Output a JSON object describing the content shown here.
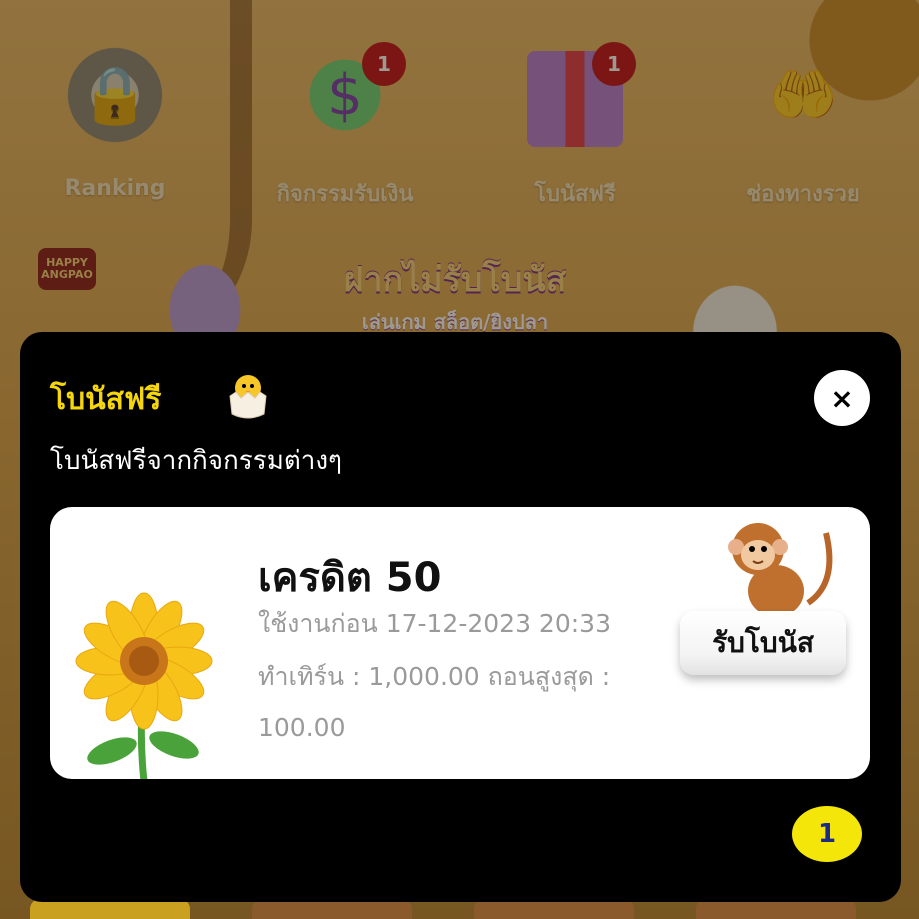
{
  "background": {
    "menu": [
      {
        "label": "Ranking",
        "icon": "lock-shield-icon",
        "badge": ""
      },
      {
        "label": "กิจกรรมรับเงิน",
        "icon": "money-bag-icon",
        "badge": "1"
      },
      {
        "label": "โบนัสฟรี",
        "icon": "gift-box-icon",
        "badge": "1"
      },
      {
        "label": "ช่องทางรวย",
        "icon": "coins-hands-icon",
        "badge": ""
      }
    ],
    "banner": {
      "title": "ฝากไม่รับโบนัส",
      "subtitle": "เล่นเกม สล็อต/ยิงปลา"
    },
    "logo_text": "HAPPY ANGPAO"
  },
  "modal": {
    "title": "โบนัสฟรี",
    "title_icon": "chick-icon",
    "close_label": "×",
    "subtitle": "โบนัสฟรีจากกิจกรรมต่างๆ",
    "card": {
      "icon": "sunflower-icon",
      "credit_title": "เครดิต 50",
      "expire_text": "ใช้งานก่อน 17-12-2023 20:33",
      "turnover_text": "ทำเทิร์น : 1,000.00  ถอนสูงสุด :",
      "max_withdraw": "100.00",
      "claim_label": "รับโบนัส",
      "mascot_icon": "monkey-icon"
    },
    "page_badge": "1"
  },
  "colors": {
    "modal_bg": "#000000",
    "title": "#f5d60a",
    "badge_yellow": "#f5e60a",
    "notif_red": "#c0101c"
  }
}
